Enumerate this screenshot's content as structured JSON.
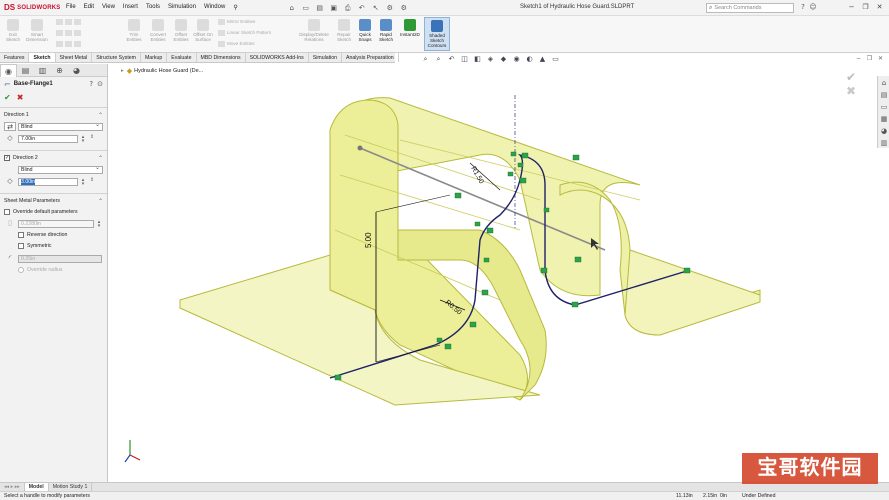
{
  "app": {
    "brand": "SOLIDWORKS",
    "logo_mark": "DS"
  },
  "window": {
    "doc_title": "Sketch1 of Hydraulic Hose Guard.SLDPRT"
  },
  "menu": [
    "File",
    "Edit",
    "View",
    "Insert",
    "Tools",
    "Simulation",
    "Window"
  ],
  "search": {
    "placeholder": "Search Commands"
  },
  "ribbon": {
    "exit_sketch": "Exit Sketch",
    "smart_dimension": "Smart Dimension",
    "trim_entities": "Trim Entities",
    "convert_entities": "Convert Entities",
    "offset_entities": "Offset Entities",
    "offset_on_surface": "Offset On Surface",
    "mirror_entities": "Mirror Entities",
    "linear_sketch_pattern": "Linear Sketch Pattern",
    "move_entities": "Move Entities",
    "display_delete_relations": "Display/Delete Relations",
    "repair_sketch": "Repair Sketch",
    "quick_snaps": "Quick Snaps",
    "rapid_sketch": "Rapid Sketch",
    "instant2d": "Instant2D",
    "shaded_sketch_contours": "Shaded Sketch Contours"
  },
  "command_tabs": [
    "Features",
    "Sketch",
    "Sheet Metal",
    "Structure System",
    "Markup",
    "Evaluate",
    "MBD Dimensions",
    "SOLIDWORKS Add-Ins",
    "Simulation",
    "Analysis Preparation"
  ],
  "active_tab": "Sketch",
  "tree": {
    "part_name": "Hydraulic Hose Guard (De..."
  },
  "property_manager": {
    "title": "Base-Flange1",
    "direction1": {
      "label": "Direction 1",
      "end_condition": "Blind",
      "depth": "7.00in"
    },
    "direction2": {
      "label": "Direction 2",
      "end_condition": "Blind",
      "depth": "3.00in",
      "checked": "✓"
    },
    "sheet_metal": {
      "label": "Sheet Metal Parameters",
      "override_default": "Override default parameters",
      "thickness": "0.2280in",
      "reverse_direction": "Reverse direction",
      "symmetric": "Symmetric",
      "radius": "0.25in",
      "override_radius": "Override radius"
    }
  },
  "dimensions": {
    "vertical": "5.00",
    "radius_top": "R1.50",
    "radius_mid": "R0.50"
  },
  "bottom_tabs": [
    "Model",
    "Motion Study 1"
  ],
  "status": {
    "message": "Select a handle to modify parameters",
    "x": "11.13in",
    "y": "2.15in",
    "z": "0in",
    "state": "Under Defined"
  },
  "watermark": "宝哥软件园",
  "colors": {
    "accent": "#c8102e",
    "sheet_fill": "#eef0a0",
    "sheet_edge": "#b8ba3c",
    "sketch": "#20206a",
    "relation": "#2aa34a"
  },
  "icons": {
    "ok": "✔",
    "cancel": "✖",
    "help": "?",
    "pin": "⊙",
    "search": "⌕"
  }
}
